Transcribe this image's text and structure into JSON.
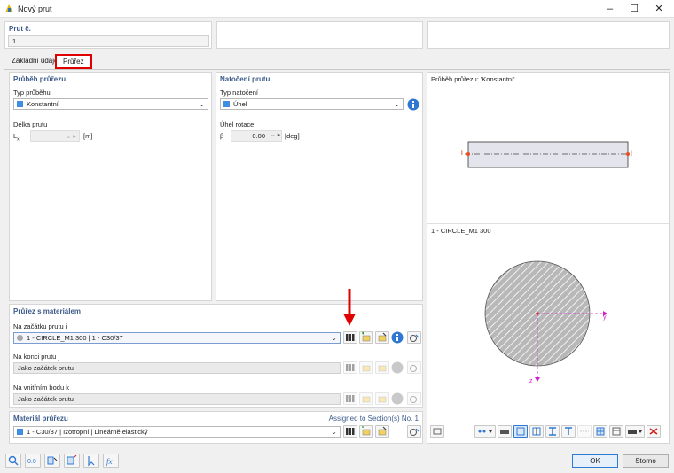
{
  "window": {
    "title": "Nový prut",
    "minimize": "–",
    "maximize": "☐",
    "close": "✕"
  },
  "member": {
    "label": "Prut č.",
    "value": "1"
  },
  "tabs": [
    {
      "label": "Základní údaje"
    },
    {
      "label": "Průřez"
    }
  ],
  "section_course": {
    "header": "Průběh průřezu",
    "type_label": "Typ průběhu",
    "type_value": "Konstantní",
    "length_label": "Délka prutu",
    "length_symbol": "L",
    "length_sub": "x",
    "length_unit": "[m]"
  },
  "rotation": {
    "header": "Natočení prutu",
    "type_label": "Typ natočení",
    "type_value": "Úhel",
    "angle_label": "Úhel rotace",
    "angle_symbol": "β",
    "angle_value": "0.00",
    "angle_unit": "[deg]"
  },
  "preview": {
    "title": "Průběh průřezu: 'Konstantní'",
    "node_i": "i",
    "node_j": "j",
    "section_name": "1 - CIRCLE_M1 300",
    "axis_y": "y",
    "axis_z": "z"
  },
  "section_material": {
    "header": "Průřez s materiálem",
    "start_label": "Na začátku prutu i",
    "start_value": "1 - CIRCLE_M1 300 | 1 - C30/37",
    "end_label": "Na konci prutu j",
    "end_value": "Jako začátek prutu",
    "inner_label": "Na vnitřním bodu k",
    "inner_value": "Jako začátek prutu"
  },
  "material": {
    "header": "Materiál průřezu",
    "assigned": "Assigned to Section(s) No. 1",
    "value": "1 - C30/37 | Izotropní | Lineárně elastický"
  },
  "buttons": {
    "ok": "OK",
    "cancel": "Storno"
  },
  "colors": {
    "accent": "#3f8fe0",
    "header_text": "#3c5a8a",
    "highlight": "#e00000",
    "magenta": "#d020d0"
  }
}
